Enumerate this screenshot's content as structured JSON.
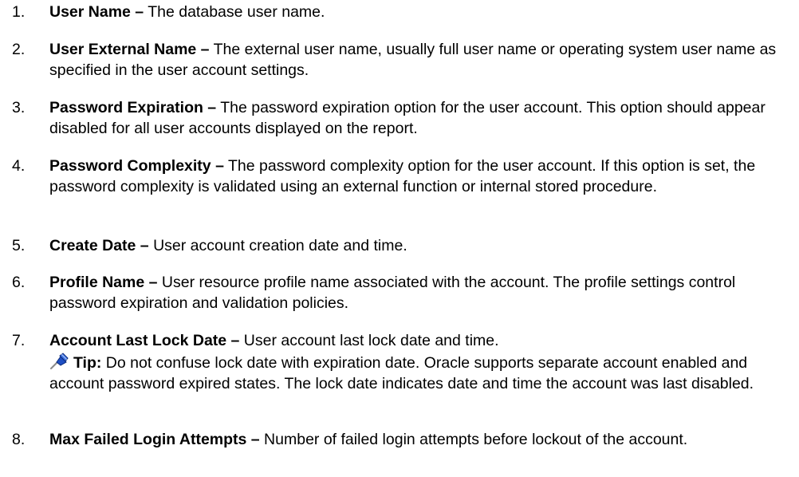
{
  "items": [
    {
      "num": "1.",
      "term": "User Name –",
      "desc": " The database user name."
    },
    {
      "num": "2.",
      "term": "User External Name –",
      "desc": " The external user name, usually full user name or operating system user name as specified in the user account settings."
    },
    {
      "num": "3.",
      "term": "Password Expiration –",
      "desc": " The password expiration option for the user account. This option should appear disabled for all user accounts displayed on the report."
    },
    {
      "num": "4.",
      "term": "Password Complexity –",
      "desc": " The password complexity option for the user account. If this option is set, the password complexity is validated using an external function or internal stored procedure."
    },
    {
      "num": "5.",
      "term": "Create Date –",
      "desc": " User account creation date and time."
    },
    {
      "num": "6.",
      "term": "Profile Name –",
      "desc": " User resource profile name associated with the account. The profile settings control password expiration and validation policies."
    },
    {
      "num": "7.",
      "term": "Account Last Lock Date –",
      "desc": " User account last lock date and time."
    },
    {
      "num": "8.",
      "term": "Max Failed Login Attempts –",
      "desc": " Number of failed login attempts before lockout of the account."
    }
  ],
  "tip": {
    "icon": "pushpin-icon",
    "label": "Tip:",
    "text": " Do not confuse lock date with expiration date. Oracle supports separate account enabled and account password expired states. The lock date indicates date and time the account was last disabled."
  }
}
